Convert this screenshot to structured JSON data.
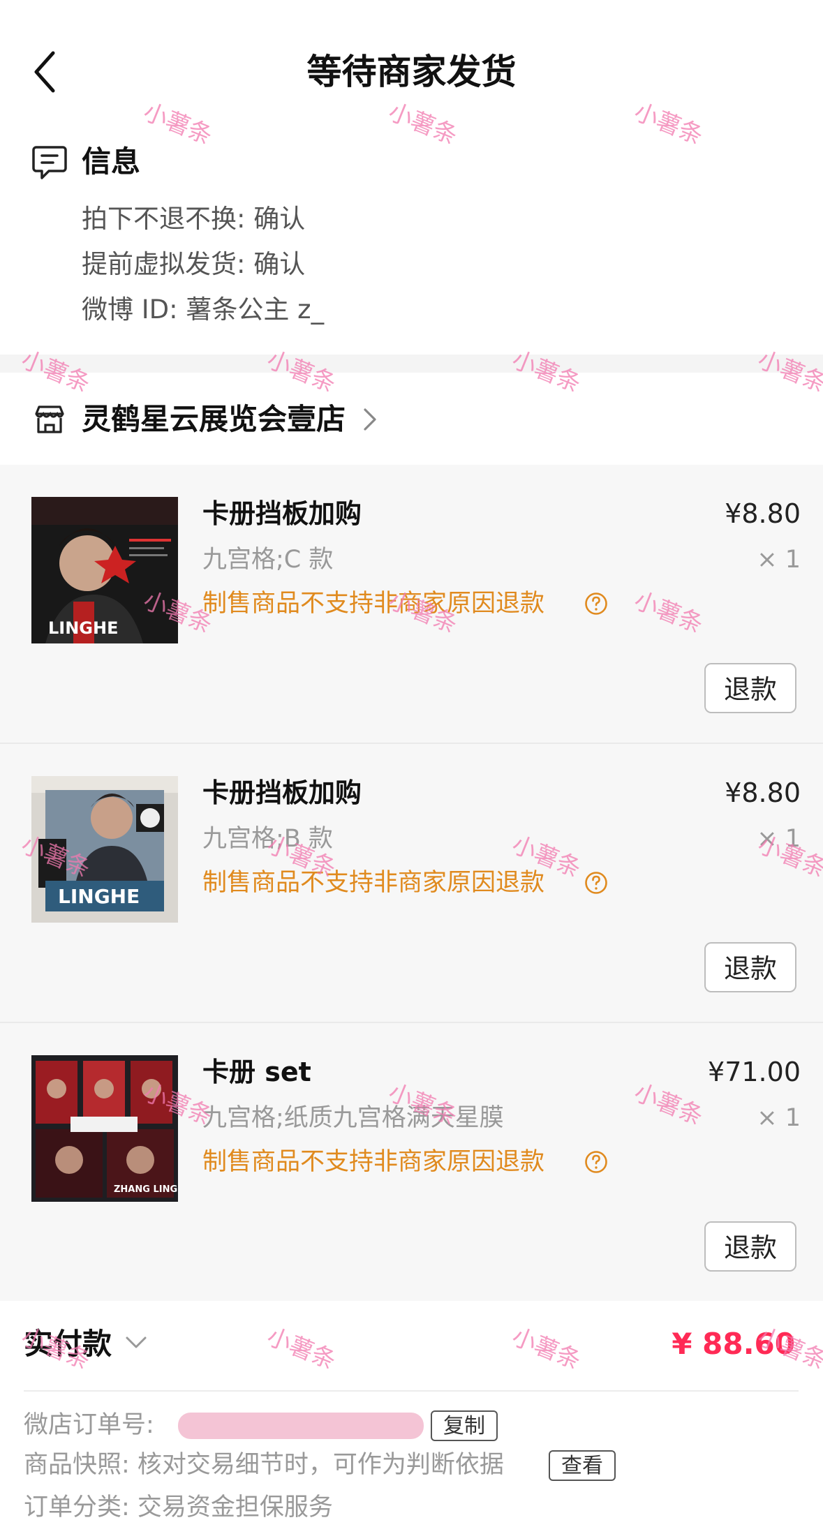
{
  "header": {
    "title": "等待商家发货"
  },
  "info": {
    "title": "信息",
    "lines": [
      "拍下不退不换: 确认",
      "提前虚拟发货: 确认",
      "微博 ID: 薯条公主 z_"
    ]
  },
  "shop": {
    "name": "灵鹤星云展览会壹店"
  },
  "products": [
    {
      "name": "卡册挡板加购",
      "price": "¥8.80",
      "spec": "九宫格;C 款",
      "qty": "× 1",
      "notice": "制售商品不支持非商家原因退款",
      "refund_label": "退款",
      "thumb_text": "LINGHE"
    },
    {
      "name": "卡册挡板加购",
      "price": "¥8.80",
      "spec": "九宫格;B 款",
      "qty": "× 1",
      "notice": "制售商品不支持非商家原因退款",
      "refund_label": "退款",
      "thumb_text": "LINGHE"
    },
    {
      "name": "卡册 set",
      "price": "¥71.00",
      "spec": "九宫格;纸质九宫格满天星膜",
      "qty": "× 1",
      "notice": "制售商品不支持非商家原因退款",
      "refund_label": "退款",
      "thumb_text": "ZHANG LINGHE"
    }
  ],
  "payment": {
    "label": "实付款",
    "amount": "¥ 88.60"
  },
  "order": {
    "number_label": "微店订单号:",
    "copy_label": "复制",
    "snapshot_text": "商品快照: 核对交易细节时，可作为判断依据",
    "view_label": "查看",
    "category_text": "订单分类: 交易资金担保服务"
  },
  "watermark": "小薯条",
  "colors": {
    "accent_red": "#ff2a55",
    "notice_orange": "#e08a1e",
    "watermark_pink": "#f27ab0"
  }
}
